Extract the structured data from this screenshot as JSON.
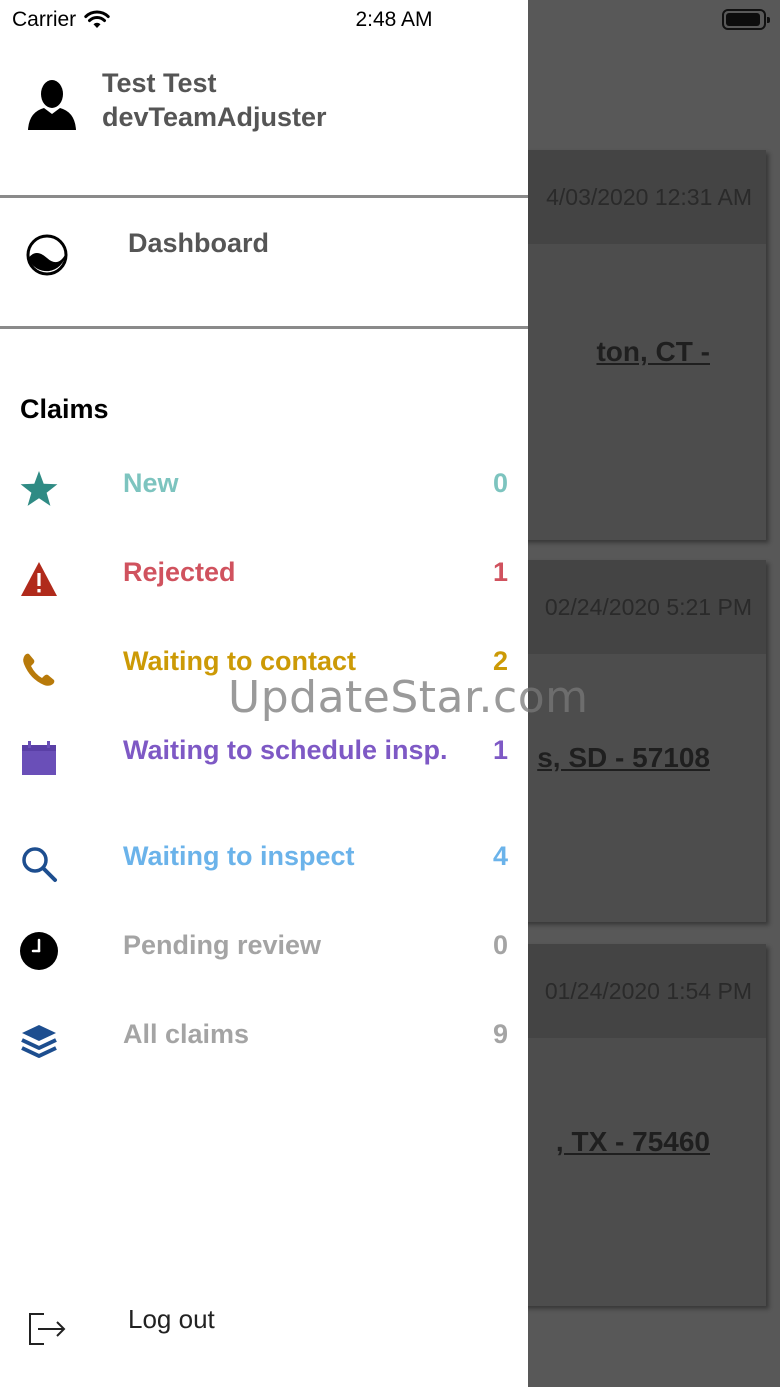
{
  "status_bar": {
    "carrier": "Carrier",
    "time": "2:48 AM"
  },
  "profile": {
    "name": "Test Test",
    "role": "devTeamAdjuster"
  },
  "dashboard": {
    "label": "Dashboard"
  },
  "claims": {
    "title": "Claims",
    "items": [
      {
        "label": "New",
        "count": "0",
        "color": "#7dc4bf",
        "icon": "star-icon"
      },
      {
        "label": "Rejected",
        "count": "1",
        "color": "#d0525e",
        "icon": "warning-icon"
      },
      {
        "label": "Waiting to contact",
        "count": "2",
        "color": "#cc9a06",
        "icon": "phone-icon"
      },
      {
        "label": "Waiting to schedule insp.",
        "count": "1",
        "color": "#7e59c5",
        "icon": "calendar-icon"
      },
      {
        "label": "Waiting to inspect",
        "count": "4",
        "color": "#6bb3ea",
        "icon": "search-icon"
      },
      {
        "label": "Pending review",
        "count": "0",
        "color": "#a4a4a4",
        "icon": "clock-icon"
      },
      {
        "label": "All claims",
        "count": "9",
        "color": "#a4a4a4",
        "icon": "layers-icon"
      }
    ]
  },
  "logout": {
    "label": "Log out"
  },
  "background_cards": [
    {
      "date": "4/03/2020 12:31 AM",
      "address": "ton, CT -"
    },
    {
      "date": "02/24/2020 5:21 PM",
      "address": "s, SD - 57108"
    },
    {
      "date": "01/24/2020 1:54 PM",
      "address": ", TX - 75460"
    }
  ],
  "watermark": "UpdateStar.com"
}
